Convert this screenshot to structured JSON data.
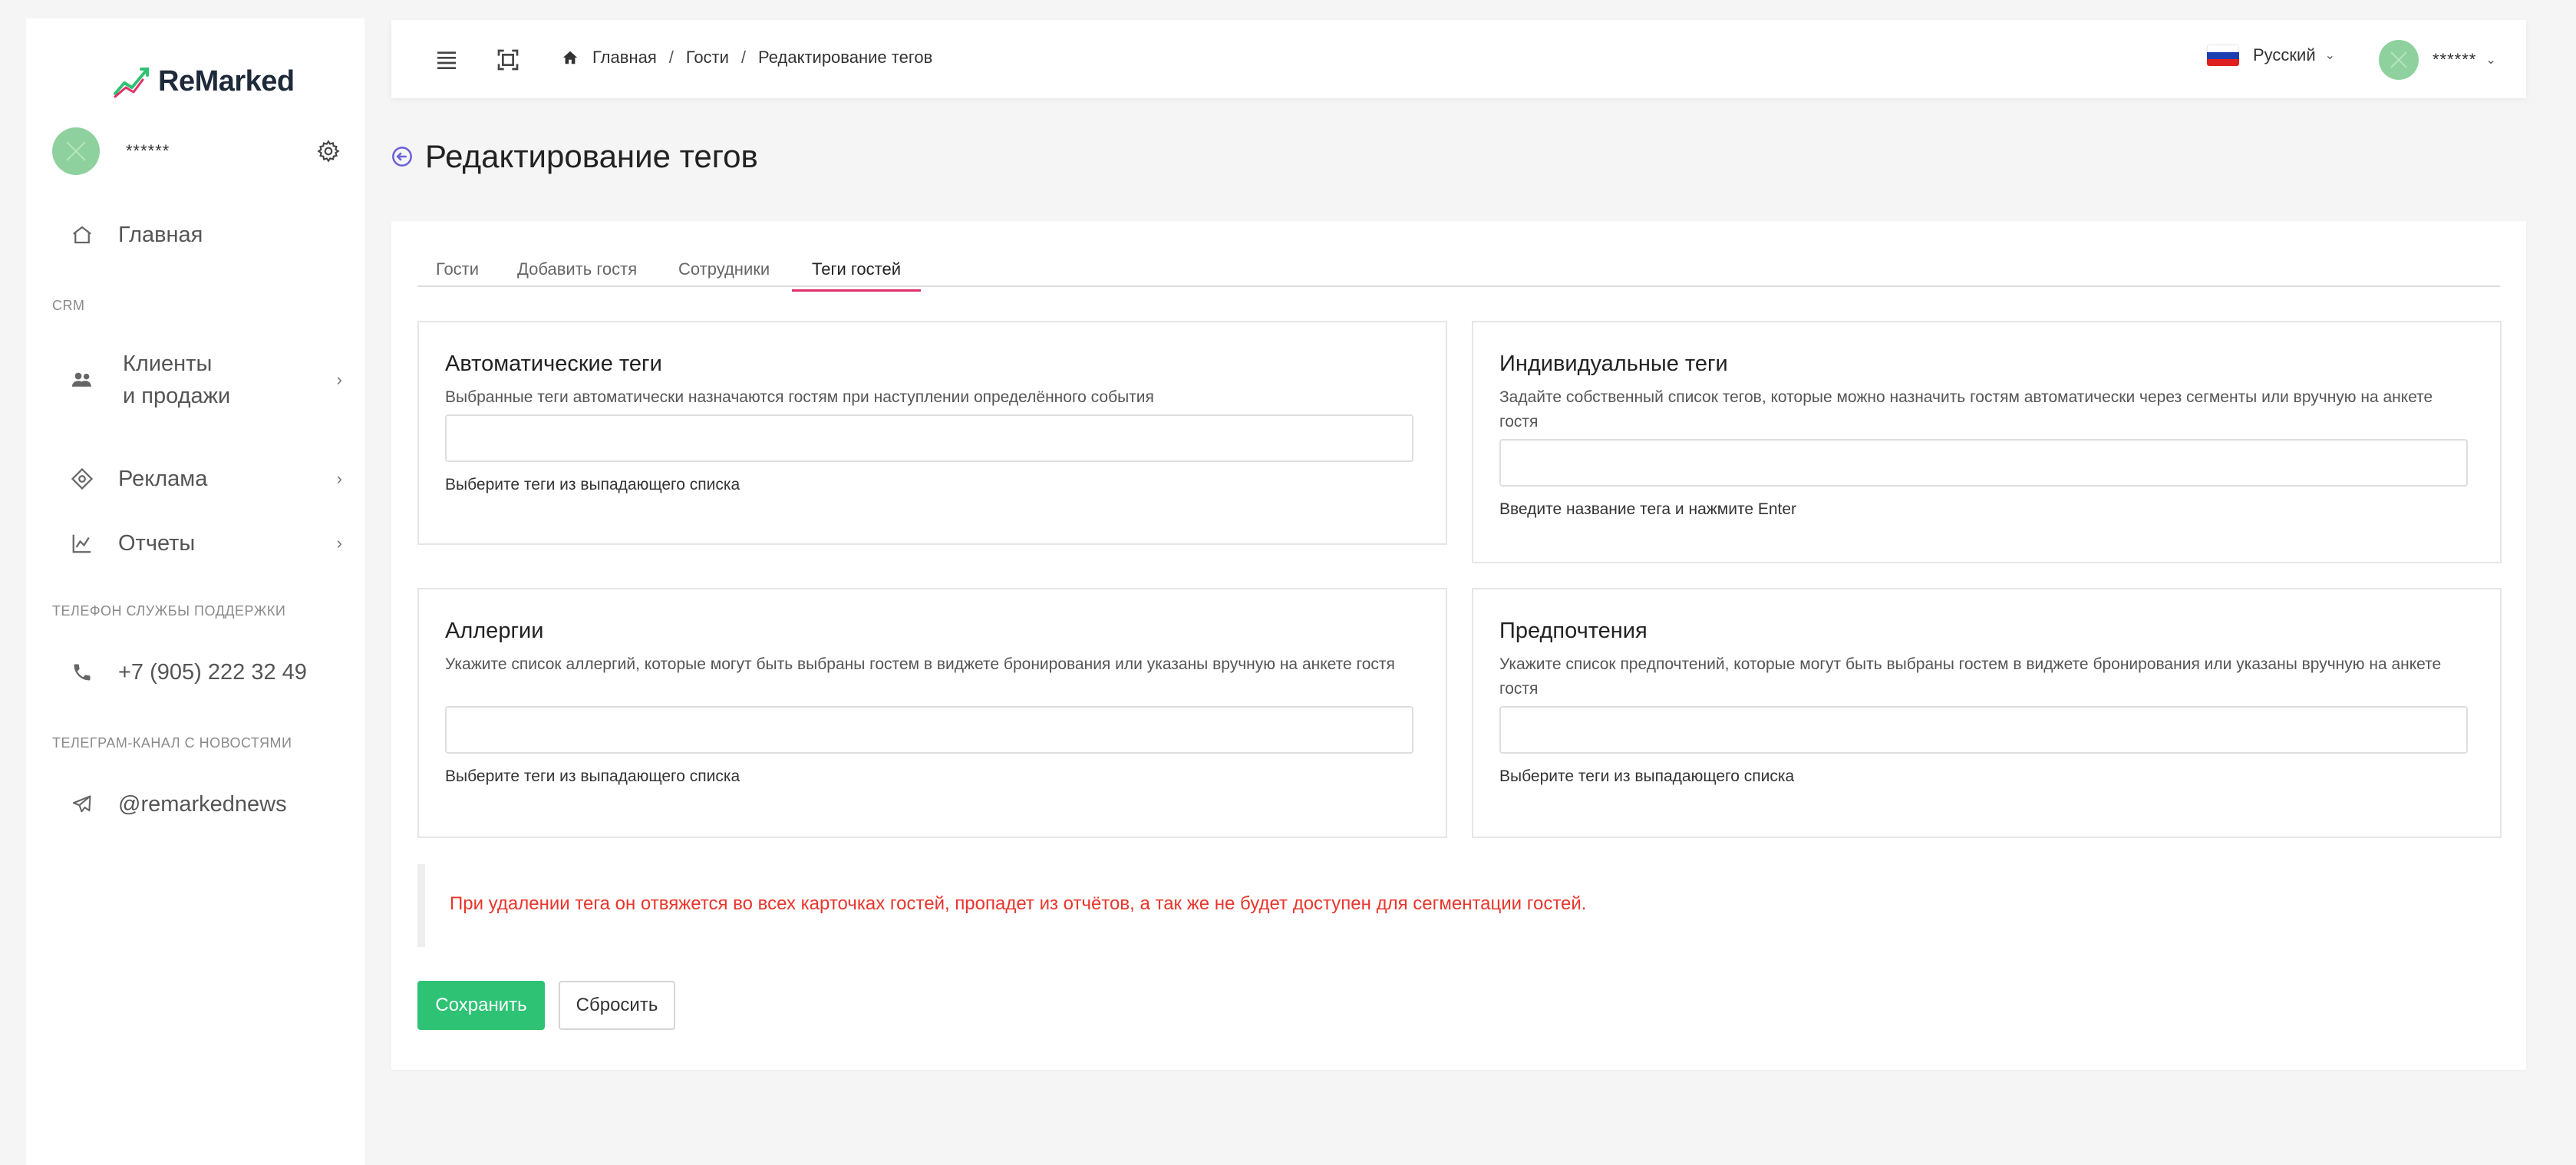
{
  "app": {
    "logo_text": "ReMarked"
  },
  "sidebar": {
    "user_name": "******",
    "items": [
      {
        "label": "Главная"
      },
      {
        "label_line1": "Клиенты",
        "label_line2": "и продажи"
      },
      {
        "label": "Реклама"
      },
      {
        "label": "Отчеты"
      }
    ],
    "section_crm": "CRM",
    "section_support": "ТЕЛЕФОН СЛУЖБЫ ПОДДЕРЖКИ",
    "support_phone": "+7 (905) 222 32 49",
    "section_telegram": "ТЕЛЕГРАМ-КАНАЛ С НОВОСТЯМИ",
    "telegram_channel": "@remarkednews"
  },
  "header": {
    "breadcrumbs": [
      "Главная",
      "Гости",
      "Редактирование тегов"
    ],
    "language": "Русский",
    "user_name": "******"
  },
  "page": {
    "title": "Редактирование тегов"
  },
  "tabs": [
    {
      "label": "Гости"
    },
    {
      "label": "Добавить гостя"
    },
    {
      "label": "Сотрудники"
    },
    {
      "label": "Теги гостей",
      "active": true
    }
  ],
  "panels": {
    "auto": {
      "title": "Автоматические теги",
      "description": "Выбранные теги автоматически назначаются гостям при наступлении определённого события",
      "input_value": "",
      "hint": "Выберите теги из выпадающего списка"
    },
    "individual": {
      "title": "Индивидуальные теги",
      "description": "Задайте собственный список тегов, которые можно назначить гостям автоматически через сегменты или вручную на анкете гостя",
      "input_value": "",
      "hint": "Введите название тега и нажмите Enter"
    },
    "allergies": {
      "title": "Аллергии",
      "description": "Укажите список аллергий, которые могут быть выбраны гостем в виджете бронирования или указаны вручную на анкете гостя",
      "input_value": "",
      "hint": "Выберите теги из выпадающего списка"
    },
    "preferences": {
      "title": "Предпочтения",
      "description": "Укажите список предпочтений, которые могут быть выбраны гостем в виджете бронирования или указаны вручную на анкете гостя",
      "input_value": "",
      "hint": "Выберите теги из выпадающего списка"
    }
  },
  "notice": "При удалении тега он отвяжется во всех карточках гостей, пропадет из отчётов, а так же не будет доступен для сегментации гостей.",
  "buttons": {
    "save": "Сохранить",
    "reset": "Сбросить"
  },
  "colors": {
    "accent_tab": "#e0306a",
    "save_button": "#2ec274",
    "notice_text": "#e8362c",
    "back_icon": "#6c63d9"
  },
  "icons": [
    "gear-icon",
    "home-icon",
    "users-icon",
    "ads-icon",
    "chart-icon",
    "phone-icon",
    "telegram-icon",
    "menu-icon",
    "fullscreen-icon",
    "back-arrow-icon",
    "chevron-down-icon",
    "chevron-right-icon"
  ]
}
